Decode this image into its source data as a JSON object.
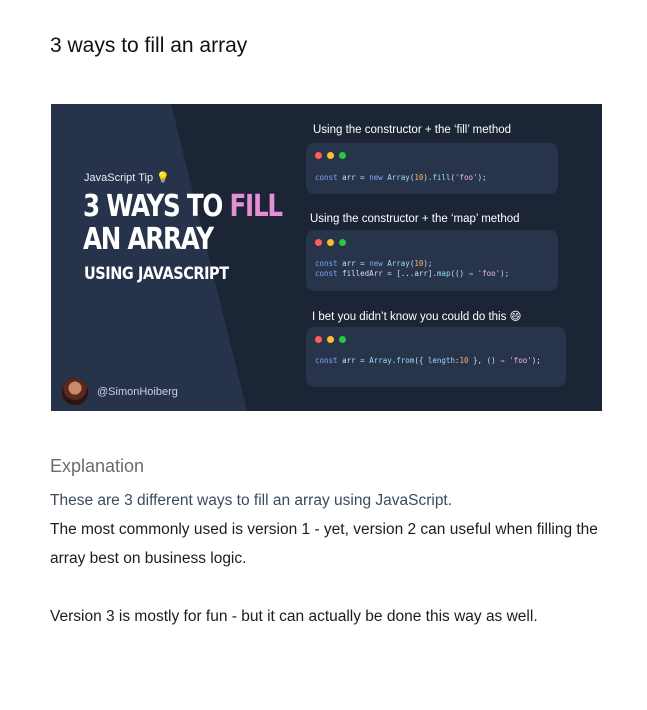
{
  "page": {
    "title": "3 ways to fill an array"
  },
  "card": {
    "tip_label": "JavaScript Tip",
    "tip_icon": "lightbulb-icon",
    "title_line1_prefix": "3 WAYS TO ",
    "title_line1_highlight": "FILL",
    "title_line2": "AN ARRAY",
    "subtitle": "USING JAVASCRIPT",
    "author_handle": "@SimonHoiberg",
    "highlight_color": "#e58fd8",
    "background_color": "#1c2535",
    "sections": [
      {
        "label": "Using the constructor + the ‘fill’ method",
        "code_lines": [
          "const arr = new Array(10).fill('foo');"
        ]
      },
      {
        "label": "Using the constructor + the ‘map’ method",
        "code_lines": [
          "const arr = new Array(10);",
          "const filledArr = [...arr].map(() ⇒ 'foo');"
        ]
      },
      {
        "label": "I bet you didn’t know you could do this",
        "label_icon": "grinning-face-icon",
        "code_lines": [
          "const arr = Array.from({ length:10 }, () ⇒ 'foo');"
        ]
      }
    ]
  },
  "explanation": {
    "heading": "Explanation",
    "intro": "These are 3 different ways to fill an array using JavaScript.",
    "paragraph2": "The most commonly used is version 1 - yet, version 2 can useful when filling the array best on business logic.",
    "paragraph3": "Version 3 is mostly for fun - but it can actually be done this way as well."
  }
}
